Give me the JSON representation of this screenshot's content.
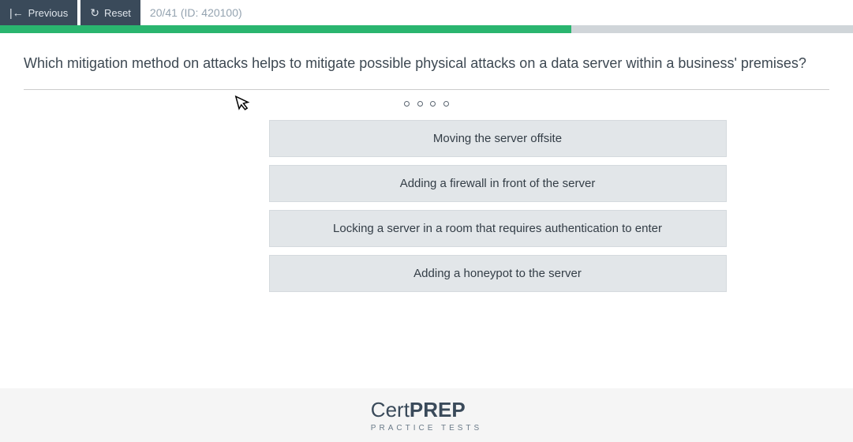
{
  "toolbar": {
    "previous_label": "Previous",
    "reset_label": "Reset",
    "counter": "20/41 (ID: 420100)"
  },
  "progress": {
    "percent": 67
  },
  "question": {
    "text": "Which mitigation method on attacks helps to mitigate possible physical attacks on a data server within a business' premises?"
  },
  "answers": [
    {
      "label": "Moving the server offsite"
    },
    {
      "label": "Adding a firewall in front of the server"
    },
    {
      "label": "Locking a server in a room that requires authentication to enter"
    },
    {
      "label": "Adding a honeypot to the server"
    }
  ],
  "brand": {
    "part1": "Cert",
    "part2": "PREP",
    "subtitle": "PRACTICE TESTS"
  }
}
